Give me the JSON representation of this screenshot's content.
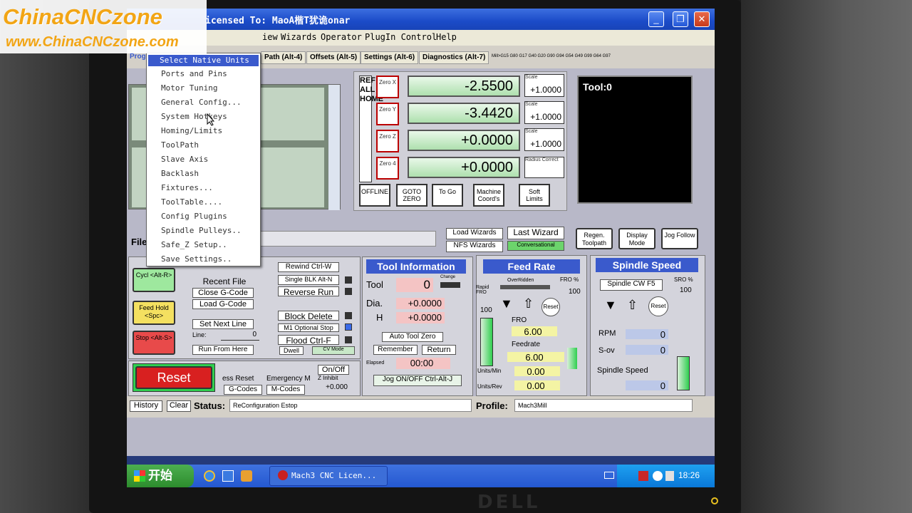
{
  "watermark": {
    "line1": "ChinaCNCzone",
    "line2": "www.ChinaCNCzone.com"
  },
  "window": {
    "title": "icensed To: MaoA楷T犹诡onar",
    "minimize": "_",
    "maximize": "❐",
    "close": "✕"
  },
  "menubar": [
    "iew",
    "Wizards",
    "Operator",
    "PlugIn Control",
    "Help"
  ],
  "tabs": [
    "Progr",
    "Path (Alt-4)",
    "Offsets (Alt-5)",
    "Settings (Alt-6)",
    "Diagnostics (Alt-7)"
  ],
  "mcode_strip": "Mill>G15  G80 G17 G40 G20 G90 G94 G54 G49 G99 G64 G97",
  "config_menu": {
    "selected": "Select Native Units",
    "items": [
      "Ports and Pins",
      "Motor Tuning",
      "General Config...",
      "System Hotkeys",
      "Homing/Limits",
      "ToolPath",
      "Slave Axis",
      "Backlash",
      "Fixtures...",
      "ToolTable....",
      "Config Plugins",
      "Spindle Pulleys..",
      "Safe_Z Setup..",
      "Save Settings.."
    ]
  },
  "dro": {
    "ref_all_home": "REF ALL HOME",
    "axes": [
      {
        "zero": "Zero X",
        "value": "-2.5500",
        "scale_label": "Scale",
        "scale": "+1.0000"
      },
      {
        "zero": "Zero Y",
        "value": "-3.4420",
        "scale_label": "Scale",
        "scale": "+1.0000"
      },
      {
        "zero": "Zero Z",
        "value": "+0.0000",
        "scale_label": "Scale",
        "scale": "+1.0000"
      },
      {
        "zero": "Zero 4",
        "value": "+0.0000",
        "scale_label": "Radius Correct",
        "scale": ""
      }
    ],
    "buttons": [
      "OFFLINE",
      "GOTO ZERO",
      "To Go",
      "Machine Coord's",
      "Soft Limits"
    ]
  },
  "tool_display": "Tool:0",
  "file_label": "File",
  "wizards": {
    "load": "Load Wizards",
    "last": "Last Wizard",
    "nfs": "NFS Wizards",
    "conv": "Conversational"
  },
  "toolpath_btns": [
    "Regen. Toolpath",
    "Display Mode",
    "Jog Follow"
  ],
  "program_run": {
    "cycle": "Cycl <Alt-R>",
    "feed_hold": "Feed Hold <Spc>",
    "stop": "Stop <Alt-S>",
    "reset": "Reset",
    "recent_file": "Recent File",
    "close_gcode": "Close G-Code",
    "load_gcode": "Load G-Code",
    "set_next_line": "Set Next Line",
    "line_label": "Line:",
    "line_value": "0",
    "run_from_here": "Run From Here",
    "rewind": "Rewind Ctrl-W",
    "single_blk": "Single BLK Alt-N",
    "reverse_run": "Reverse Run",
    "block_delete": "Block Delete",
    "m1_optional": "M1 Optional Stop",
    "flood": "Flood Ctrl-F",
    "dwell": "Dwell",
    "cv_mode": "CV Mode",
    "on_off": "On/Off",
    "z_inhibit": "Z Inhibit",
    "z_inhibit_val": "+0.000",
    "ess_reset": "ess Reset",
    "emergency": "Emergency M",
    "gcodes": "G-Codes",
    "mcodes": "M-Codes"
  },
  "tool_info": {
    "title": "Tool Information",
    "tool_label": "Tool",
    "tool_val": "0",
    "change_label": "Change",
    "dia_label": "Dia.",
    "dia_val": "+0.0000",
    "h_label": "H",
    "h_val": "+0.0000",
    "auto_zero": "Auto Tool Zero",
    "remember": "Remember",
    "return": "Return",
    "elapsed_label": "Elapsed",
    "elapsed_val": "00:00",
    "jog": "Jog ON/OFF Ctrl-Alt-J"
  },
  "feed_rate": {
    "title": "Feed Rate",
    "overridden": "OverRidden",
    "fro_pct": "FRO %",
    "fro_pct_val": "100",
    "rapid_fro": "Rapid FRO",
    "rapid_val": "100",
    "reset": "Reset",
    "fro_label": "FRO",
    "fro_val": "6.00",
    "feedrate_label": "Feedrate",
    "feedrate_val": "6.00",
    "units_min": "Units/Min",
    "units_min_val": "0.00",
    "units_rev": "Units/Rev",
    "units_rev_val": "0.00"
  },
  "spindle": {
    "title": "Spindle Speed",
    "cw": "Spindle CW F5",
    "sro": "SRO %",
    "sro_val": "100",
    "reset": "Reset",
    "rpm_label": "RPM",
    "rpm_val": "0",
    "sov_label": "S-ov",
    "sov_val": "0",
    "speed_label": "Spindle Speed",
    "speed_val": "0"
  },
  "status": {
    "history": "History",
    "clear": "Clear",
    "label": "Status:",
    "text": "ReConfiguration Estop",
    "profile_label": "Profile:",
    "profile": "Mach3Mill"
  },
  "taskbar": {
    "start": "开始",
    "task": "Mach3 CNC  Licen...",
    "clock": "18:26"
  },
  "brand": "DELL"
}
